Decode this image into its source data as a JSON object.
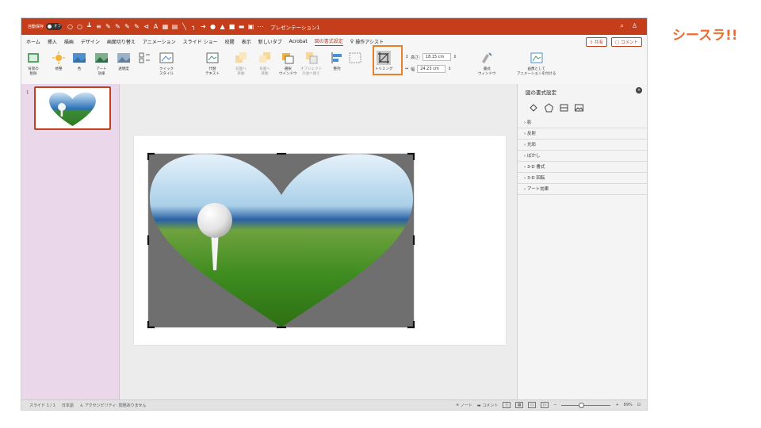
{
  "brand": {
    "logo_text": "シースラ!!"
  },
  "titlebar": {
    "autosave_label": "自動保存",
    "autosave_state": "オフ",
    "doc_title": "プレゼンテーション1",
    "search_icon": "search-icon",
    "share_icon": "person-share-icon"
  },
  "menubar": {
    "tabs": [
      "ホーム",
      "挿入",
      "描画",
      "デザイン",
      "画面切り替え",
      "アニメーション",
      "スライド ショー",
      "校閲",
      "表示",
      "新しいタブ",
      "Acrobat",
      "図の書式設定"
    ],
    "active_tab": "図の書式設定",
    "tell_me": "操作アシスト",
    "share_label": "共有",
    "comment_label": "コメント"
  },
  "ribbon": {
    "remove_bg": "背景の\n削除",
    "corrections": "修整",
    "color": "色",
    "artistic": "アート\n効果",
    "transparency": "透明度",
    "quick_styles": "クイック\nスタイル",
    "alt_text": "代替\nテキスト",
    "bring_forward": "前面へ\n移動",
    "send_backward": "背面へ\n移動",
    "selection_pane": "選択\nウインドウ",
    "reorder": "オブジェクト\nの並べ替え",
    "align": "整列",
    "crop": "トリミング",
    "height_label": "高さ:",
    "height_value": "18.15 cm",
    "width_label": "幅",
    "width_value": "24.23 cm",
    "format_pane": "書式\nウィンドウ",
    "save_as_picture": "画像として\nアニメーションを付ける"
  },
  "thumbnails": {
    "slide_number": "1"
  },
  "format_pane": {
    "title": "図の書式設定",
    "sections": [
      "影",
      "反射",
      "光彩",
      "ぼかし",
      "3-D 書式",
      "3-D 回転",
      "アート効果"
    ]
  },
  "statusbar": {
    "slide_info": "スライド 1 / 1",
    "language": "日本語",
    "accessibility": "アクセシビリティ: 問題ありません",
    "notes": "ノート",
    "comments": "コメント",
    "zoom": "89%"
  },
  "colors": {
    "accent": "#c43e1c",
    "highlight": "#e8802b",
    "brand": "#ef6b2e",
    "thumb_bg": "#ead7ea"
  }
}
